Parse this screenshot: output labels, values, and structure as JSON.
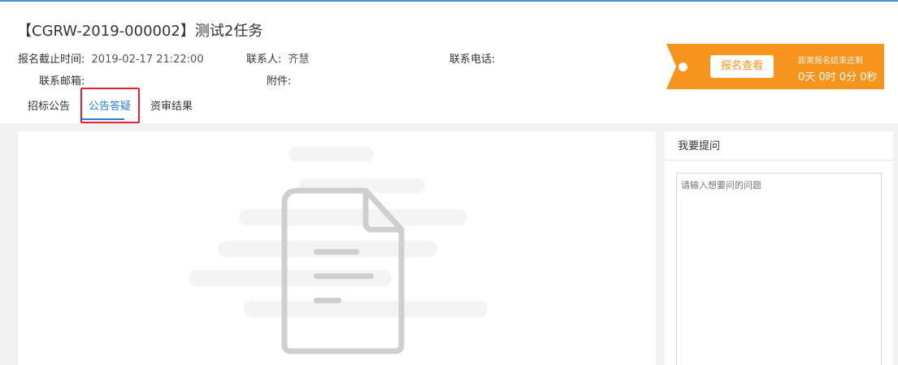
{
  "header": {
    "title": "【CGRW-2019-000002】测试2任务"
  },
  "info": {
    "deadline_label": "报名截止时间:",
    "deadline_value": "2019-02-17 21:22:00",
    "contact_label": "联系人:",
    "contact_value": "齐慧",
    "phone_label": "联系电话:",
    "phone_value": "",
    "email_label": "联系邮箱:",
    "email_value": "",
    "attachment_label": "附件:",
    "attachment_value": ""
  },
  "tabs": [
    {
      "label": "招标公告",
      "active": false
    },
    {
      "label": "公告答疑",
      "active": true
    },
    {
      "label": "资审结果",
      "active": false
    }
  ],
  "banner": {
    "button_label": "报名查看",
    "countdown_label": "距离报名结束还剩",
    "countdown_value": "0天 0时 0分 0秒",
    "color": "#f7941d"
  },
  "question_panel": {
    "title": "我要提问",
    "placeholder": "请输入想要问的问题"
  },
  "colors": {
    "accent": "#2a7ed6",
    "highlight": "#e0242c",
    "top_rule": "#4a90d9"
  },
  "icons": {
    "empty_state": "document-icon"
  }
}
